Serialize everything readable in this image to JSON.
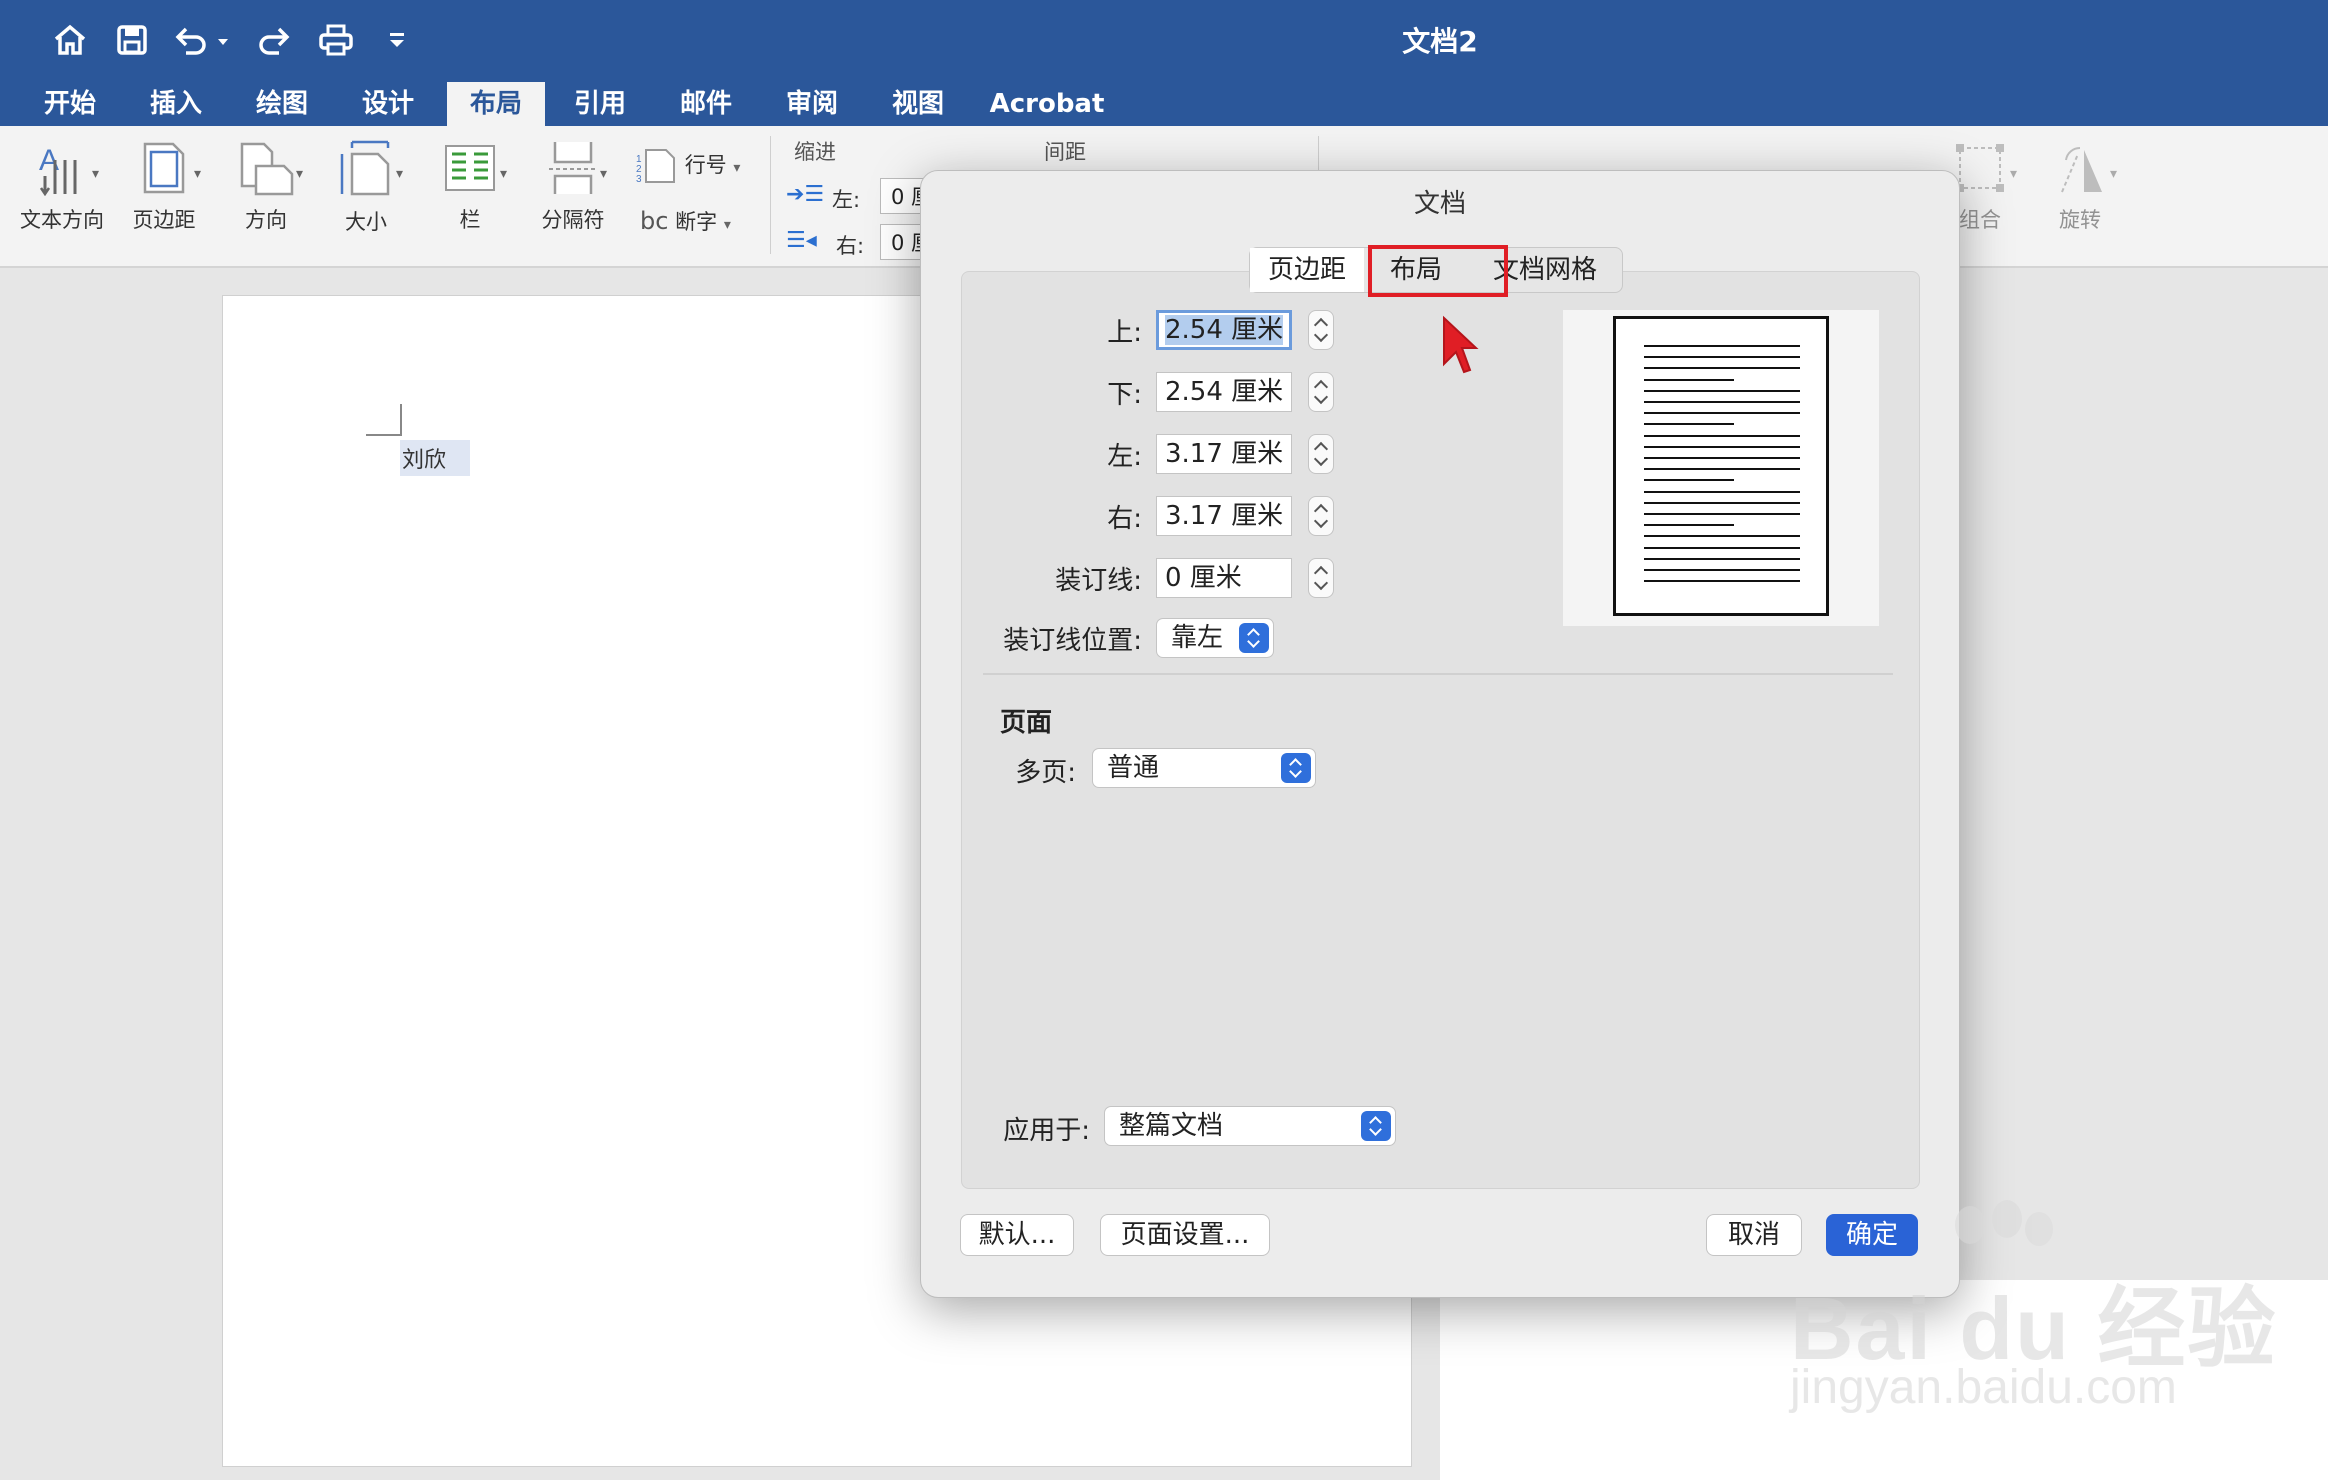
{
  "window": {
    "title": "文档2"
  },
  "ribbon_tabs": [
    "开始",
    "插入",
    "绘图",
    "设计",
    "布局",
    "引用",
    "邮件",
    "审阅",
    "视图",
    "Acrobat"
  ],
  "active_tab": "布局",
  "ribbon": {
    "text_direction": "文本方向",
    "margins": "页边距",
    "orientation": "方向",
    "size": "大小",
    "columns": "栏",
    "breaks": "分隔符",
    "line_numbers": "行号",
    "hyphenation": "断字",
    "indent_title": "缩进",
    "spacing_title": "间距",
    "indent_left_label": "左:",
    "indent_right_label": "右:",
    "indent_left_value": "0 厘",
    "indent_right_value": "0 厘",
    "group": "组合",
    "rotate": "旋转"
  },
  "document": {
    "text": "刘欣"
  },
  "dialog": {
    "title": "文档",
    "tabs": [
      "页边距",
      "布局",
      "文档网格"
    ],
    "selected_tab": "页边距",
    "margins": [
      {
        "label": "上:",
        "value": "2.54 厘米"
      },
      {
        "label": "下:",
        "value": "2.54 厘米"
      },
      {
        "label": "左:",
        "value": "3.17 厘米"
      },
      {
        "label": "右:",
        "value": "3.17 厘米"
      },
      {
        "label": "装订线:",
        "value": "0 厘米"
      }
    ],
    "gutter_position_label": "装订线位置:",
    "gutter_position_value": "靠左",
    "pages_section": "页面",
    "multiple_pages_label": "多页:",
    "multiple_pages_value": "普通",
    "apply_to_label": "应用于:",
    "apply_to_value": "整篇文档",
    "default_button": "默认...",
    "page_setup_button": "页面设置...",
    "cancel_button": "取消",
    "ok_button": "确定"
  },
  "watermark": {
    "brand": "Bai du 经验",
    "url": "jingyan.baidu.com"
  },
  "colors": {
    "title_bar": "#2b579a",
    "highlight": "#e01e25",
    "primary": "#2a63d6"
  }
}
